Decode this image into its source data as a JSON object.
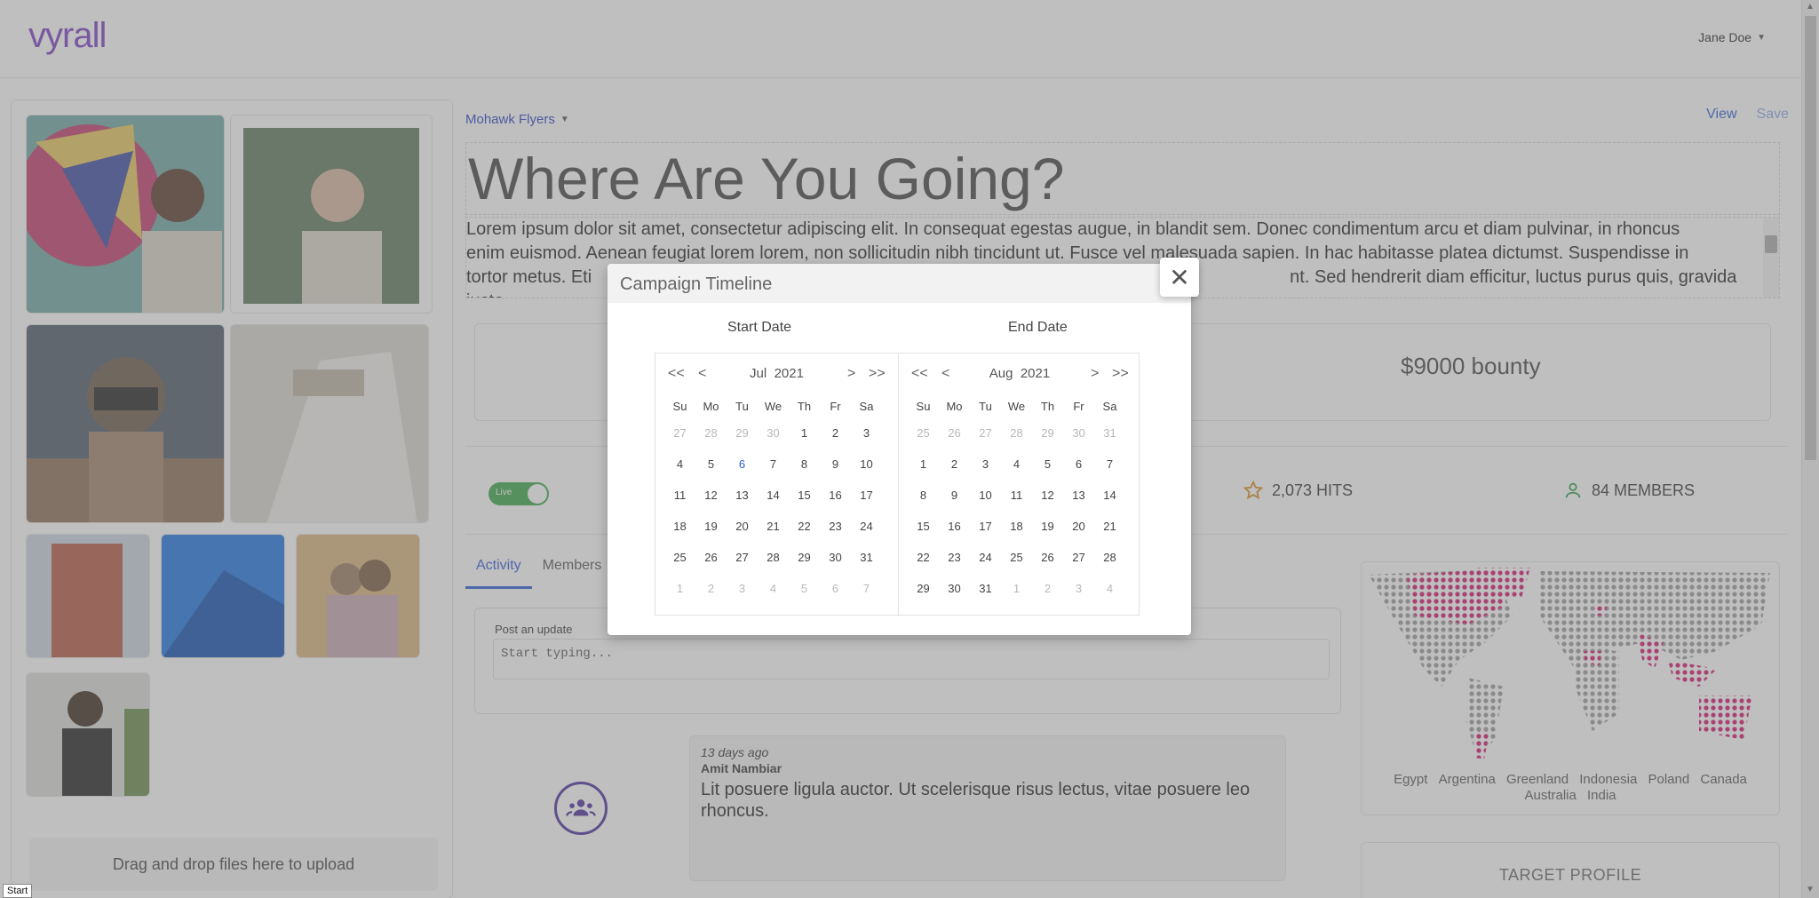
{
  "header": {
    "logo": "vyrall",
    "user": "Jane Doe"
  },
  "gallery": {
    "upload_text": "Drag and drop files here to upload"
  },
  "main": {
    "campaign": "Mohawk Flyers",
    "view_label": "View",
    "save_label": "Save",
    "headline": "Where Are You Going?",
    "description_line1": "Lorem ipsum dolor sit amet, consectetur adipiscing elit. In consequat egestas augue, in blandit sem. Donec condimentum arcu et diam pulvinar, in rhoncus",
    "description_line2": "enim euismod. Aenean feugiat lorem lorem, non sollicitudin nibh tincidunt ut. Fusce vel malesuada sapien. In hac habitasse platea dictumst. Suspendisse in",
    "description_line3_start": "tortor metus. Eti",
    "description_line3_end": "nt. Sed hendrerit diam efficitur, luctus purus quis, gravida justo.",
    "bounty": "$9000 bounty",
    "live_label": "Live",
    "hits": "2,073 HITS",
    "members": "84 MEMBERS",
    "tabs": [
      "Activity",
      "Members"
    ],
    "post": {
      "label": "Post an update",
      "placeholder": "Start typing..."
    },
    "feed": {
      "time": "13 days ago",
      "author": "Amit Nambiar",
      "text": "Lit posuere ligula auctor. Ut scelerisque risus lectus, vitae posuere leo rhoncus."
    },
    "map_legend": [
      "Egypt",
      "Argentina",
      "Greenland",
      "Indonesia",
      "Poland",
      "Canada",
      "Australia",
      "India"
    ],
    "target_title": "TARGET PROFILE"
  },
  "modal": {
    "title": "Campaign Timeline",
    "start_label": "Start Date",
    "end_label": "End Date",
    "left": {
      "month": "Jul",
      "year": "2021",
      "weeks": [
        [
          "27",
          "28",
          "29",
          "30",
          "1",
          "2",
          "3"
        ],
        [
          "4",
          "5",
          "6",
          "7",
          "8",
          "9",
          "10"
        ],
        [
          "11",
          "12",
          "13",
          "14",
          "15",
          "16",
          "17"
        ],
        [
          "18",
          "19",
          "20",
          "21",
          "22",
          "23",
          "24"
        ],
        [
          "25",
          "26",
          "27",
          "28",
          "29",
          "30",
          "31"
        ],
        [
          "1",
          "2",
          "3",
          "4",
          "5",
          "6",
          "7"
        ]
      ]
    },
    "right": {
      "month": "Aug",
      "year": "2021",
      "weeks": [
        [
          "25",
          "26",
          "27",
          "28",
          "29",
          "30",
          "31"
        ],
        [
          "1",
          "2",
          "3",
          "4",
          "5",
          "6",
          "7"
        ],
        [
          "8",
          "9",
          "10",
          "11",
          "12",
          "13",
          "14"
        ],
        [
          "15",
          "16",
          "17",
          "18",
          "19",
          "20",
          "21"
        ],
        [
          "22",
          "23",
          "24",
          "25",
          "26",
          "27",
          "28"
        ],
        [
          "29",
          "30",
          "31",
          "1",
          "2",
          "3",
          "4"
        ]
      ]
    },
    "weekdays": [
      "Su",
      "Mo",
      "Tu",
      "We",
      "Th",
      "Fr",
      "Sa"
    ],
    "nav": {
      "prev_year": "<<",
      "prev": "<",
      "next": ">",
      "next_year": ">>"
    }
  },
  "status_tip": "Start",
  "colors": {
    "accent": "#2b5bd7",
    "brand": "#7b3fc4",
    "live": "#3aa74a",
    "map_hot": "#d6136e"
  }
}
